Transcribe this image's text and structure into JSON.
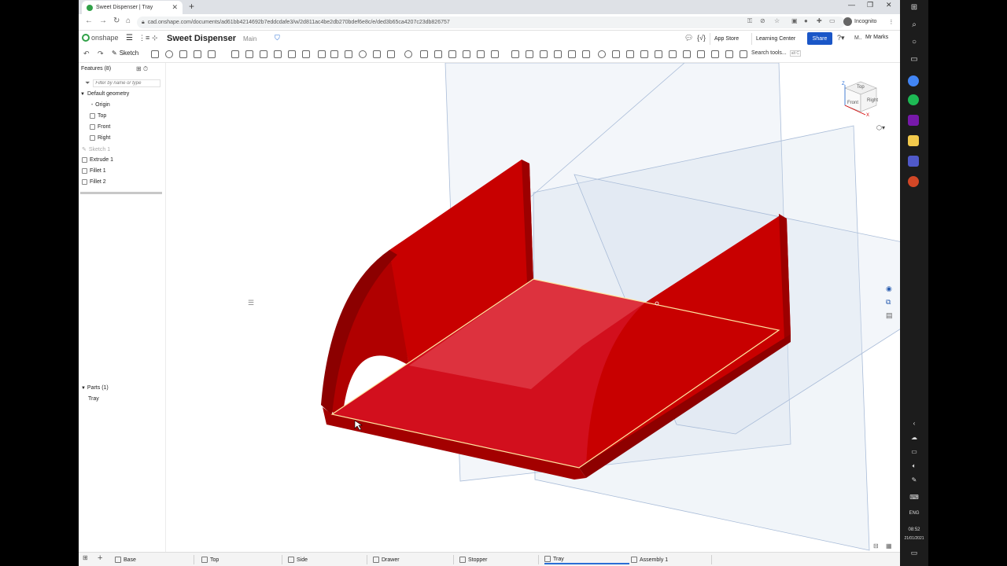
{
  "browser": {
    "tab_title": "Sweet Dispenser | Tray",
    "tab_close": "✕",
    "new_tab": "+",
    "url": "cad.onshape.com/documents/ad61bb4214692b7eddcdafe3/w/2d811ac4be2db270bdef6e8c/e/ded3b65ca4207c23db826757",
    "incognito": "Incognito"
  },
  "header": {
    "logo": "onshape",
    "doc_title": "Sweet Dispenser",
    "branch": "Main",
    "app_store": "App Store",
    "learning_center": "Learning Center",
    "share": "Share",
    "user": "Mr Marks"
  },
  "toolbar": {
    "sketch": "Sketch",
    "search_tools": "Search tools...",
    "search_shortcut": "alt C"
  },
  "features": {
    "title": "Features (8)",
    "filter_placeholder": "Filter by name or type",
    "default_geometry": "Default geometry",
    "items": [
      "Origin",
      "Top",
      "Front",
      "Right",
      "Sketch 1",
      "Extrude 1",
      "Fillet 1",
      "Fillet 2"
    ]
  },
  "parts": {
    "title": "Parts (1)",
    "items": [
      "Tray"
    ]
  },
  "viewcube": {
    "top": "Top",
    "front": "Front",
    "right": "Right",
    "z": "Z",
    "x": "X"
  },
  "bottom_tabs": [
    "Base",
    "Top",
    "Side",
    "Drawer",
    "Stopper",
    "Tray",
    "Assembly 1"
  ],
  "active_tab": "Tray",
  "taskbar": {
    "lang": "ENG",
    "time": "08:52",
    "date": "21/01/2021"
  },
  "colors": {
    "part_red": "#d40000",
    "accent_blue": "#1a56c7",
    "plane_blue": "#9fb6d6"
  }
}
